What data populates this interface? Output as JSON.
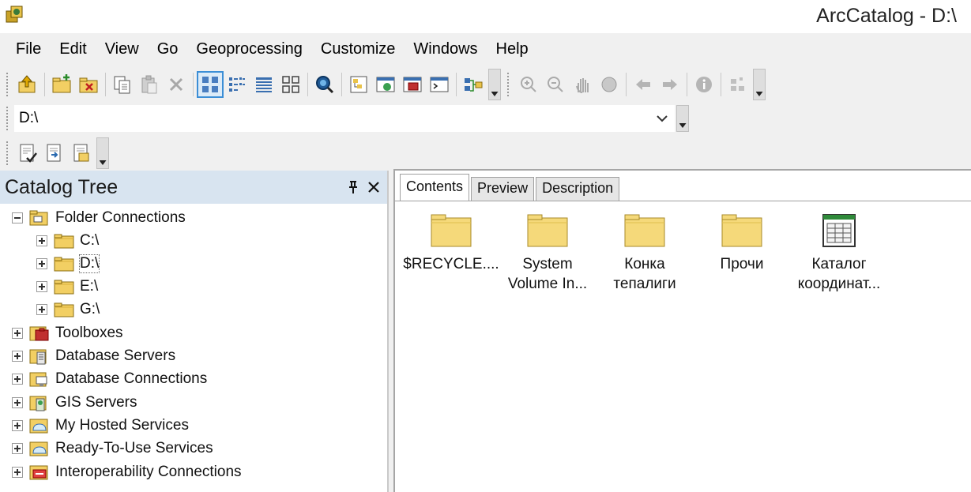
{
  "window": {
    "title": "ArcCatalog - D:\\",
    "app_icon": "arccatalog-app-icon"
  },
  "menu": {
    "items": [
      "File",
      "Edit",
      "View",
      "Go",
      "Geoprocessing",
      "Customize",
      "Windows",
      "Help"
    ]
  },
  "toolbar": {
    "buttons": [
      "up-one-level-icon",
      "connect-folder-icon",
      "disconnect-folder-icon",
      "copy-icon",
      "paste-icon",
      "delete-icon",
      "large-icons-view-icon",
      "list-view-icon",
      "details-view-icon",
      "thumbnails-view-icon",
      "arcgis-search-icon",
      "catalog-tree-icon",
      "arcmap-window-icon",
      "arctoolbox-icon",
      "python-window-icon",
      "model-builder-icon",
      "zoom-in-icon",
      "zoom-out-icon",
      "pan-icon",
      "full-extent-icon",
      "back-icon",
      "forward-icon",
      "identify-icon",
      "create-thumbnail-icon"
    ]
  },
  "location": {
    "value": "D:\\"
  },
  "metadata_toolbar": {
    "buttons": [
      "validate-metadata-icon",
      "import-metadata-icon",
      "export-metadata-icon"
    ]
  },
  "catalog_tree": {
    "title": "Catalog Tree",
    "pin_icon": "pin-icon",
    "close_icon": "close-icon",
    "nodes": [
      {
        "label": "Folder Connections",
        "icon": "folder-connections-icon",
        "expanded": true
      },
      {
        "label": "C:\\",
        "icon": "folder-icon",
        "expanded": false
      },
      {
        "label": "D:\\",
        "icon": "folder-icon",
        "expanded": false,
        "selected": true
      },
      {
        "label": "E:\\",
        "icon": "folder-icon",
        "expanded": false
      },
      {
        "label": "G:\\",
        "icon": "folder-icon",
        "expanded": false
      },
      {
        "label": "Toolboxes",
        "icon": "toolbox-icon",
        "expanded": false
      },
      {
        "label": "Database Servers",
        "icon": "database-servers-icon",
        "expanded": false
      },
      {
        "label": "Database Connections",
        "icon": "database-connections-icon",
        "expanded": false
      },
      {
        "label": "GIS Servers",
        "icon": "gis-servers-icon",
        "expanded": false
      },
      {
        "label": "My Hosted Services",
        "icon": "hosted-services-icon",
        "expanded": false
      },
      {
        "label": "Ready-To-Use Services",
        "icon": "ready-to-use-services-icon",
        "expanded": false
      },
      {
        "label": "Interoperability Connections",
        "icon": "interoperability-icon",
        "expanded": false
      }
    ]
  },
  "content": {
    "tabs": [
      {
        "label": "Contents",
        "active": true
      },
      {
        "label": "Preview",
        "active": false
      },
      {
        "label": "Description",
        "active": false
      }
    ],
    "items": [
      {
        "line1": "$RECYCLE....",
        "line2": "",
        "icon": "folder-icon"
      },
      {
        "line1": "System",
        "line2": "Volume In...",
        "icon": "folder-icon"
      },
      {
        "line1": "Конка",
        "line2": "тепалиги",
        "icon": "folder-icon"
      },
      {
        "line1": "Прочи",
        "line2": "",
        "icon": "folder-icon"
      },
      {
        "line1": "Каталог",
        "line2": "координат...",
        "icon": "table-icon"
      }
    ]
  },
  "colors": {
    "panel_header": "#d8e4f0",
    "folder_yellow": "#f5d97a",
    "active_view": "#3b8ed6"
  }
}
